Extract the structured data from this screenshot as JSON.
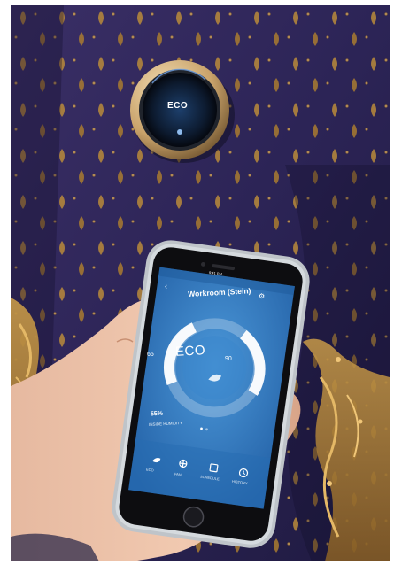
{
  "thermostat": {
    "mode_label": "ECO"
  },
  "phone": {
    "status_time": "9:41 PM",
    "title": "Workroom (Stein)",
    "mode_label": "ECO",
    "low_setpoint": "65",
    "high_setpoint": "90",
    "humidity_value": "55%",
    "humidity_label": "INSIDE HUMIDITY",
    "nav": [
      {
        "label": "ECO",
        "icon": "leaf-icon"
      },
      {
        "label": "FAN",
        "icon": "fan-icon"
      },
      {
        "label": "SCHEDULE",
        "icon": "calendar-icon"
      },
      {
        "label": "HISTORY",
        "icon": "clock-icon"
      }
    ]
  },
  "colors": {
    "fabric": "#2c2456",
    "gold": "#b98a3a",
    "screen": "#2f7fc8",
    "thermostat_ring": "#c9a36b"
  }
}
